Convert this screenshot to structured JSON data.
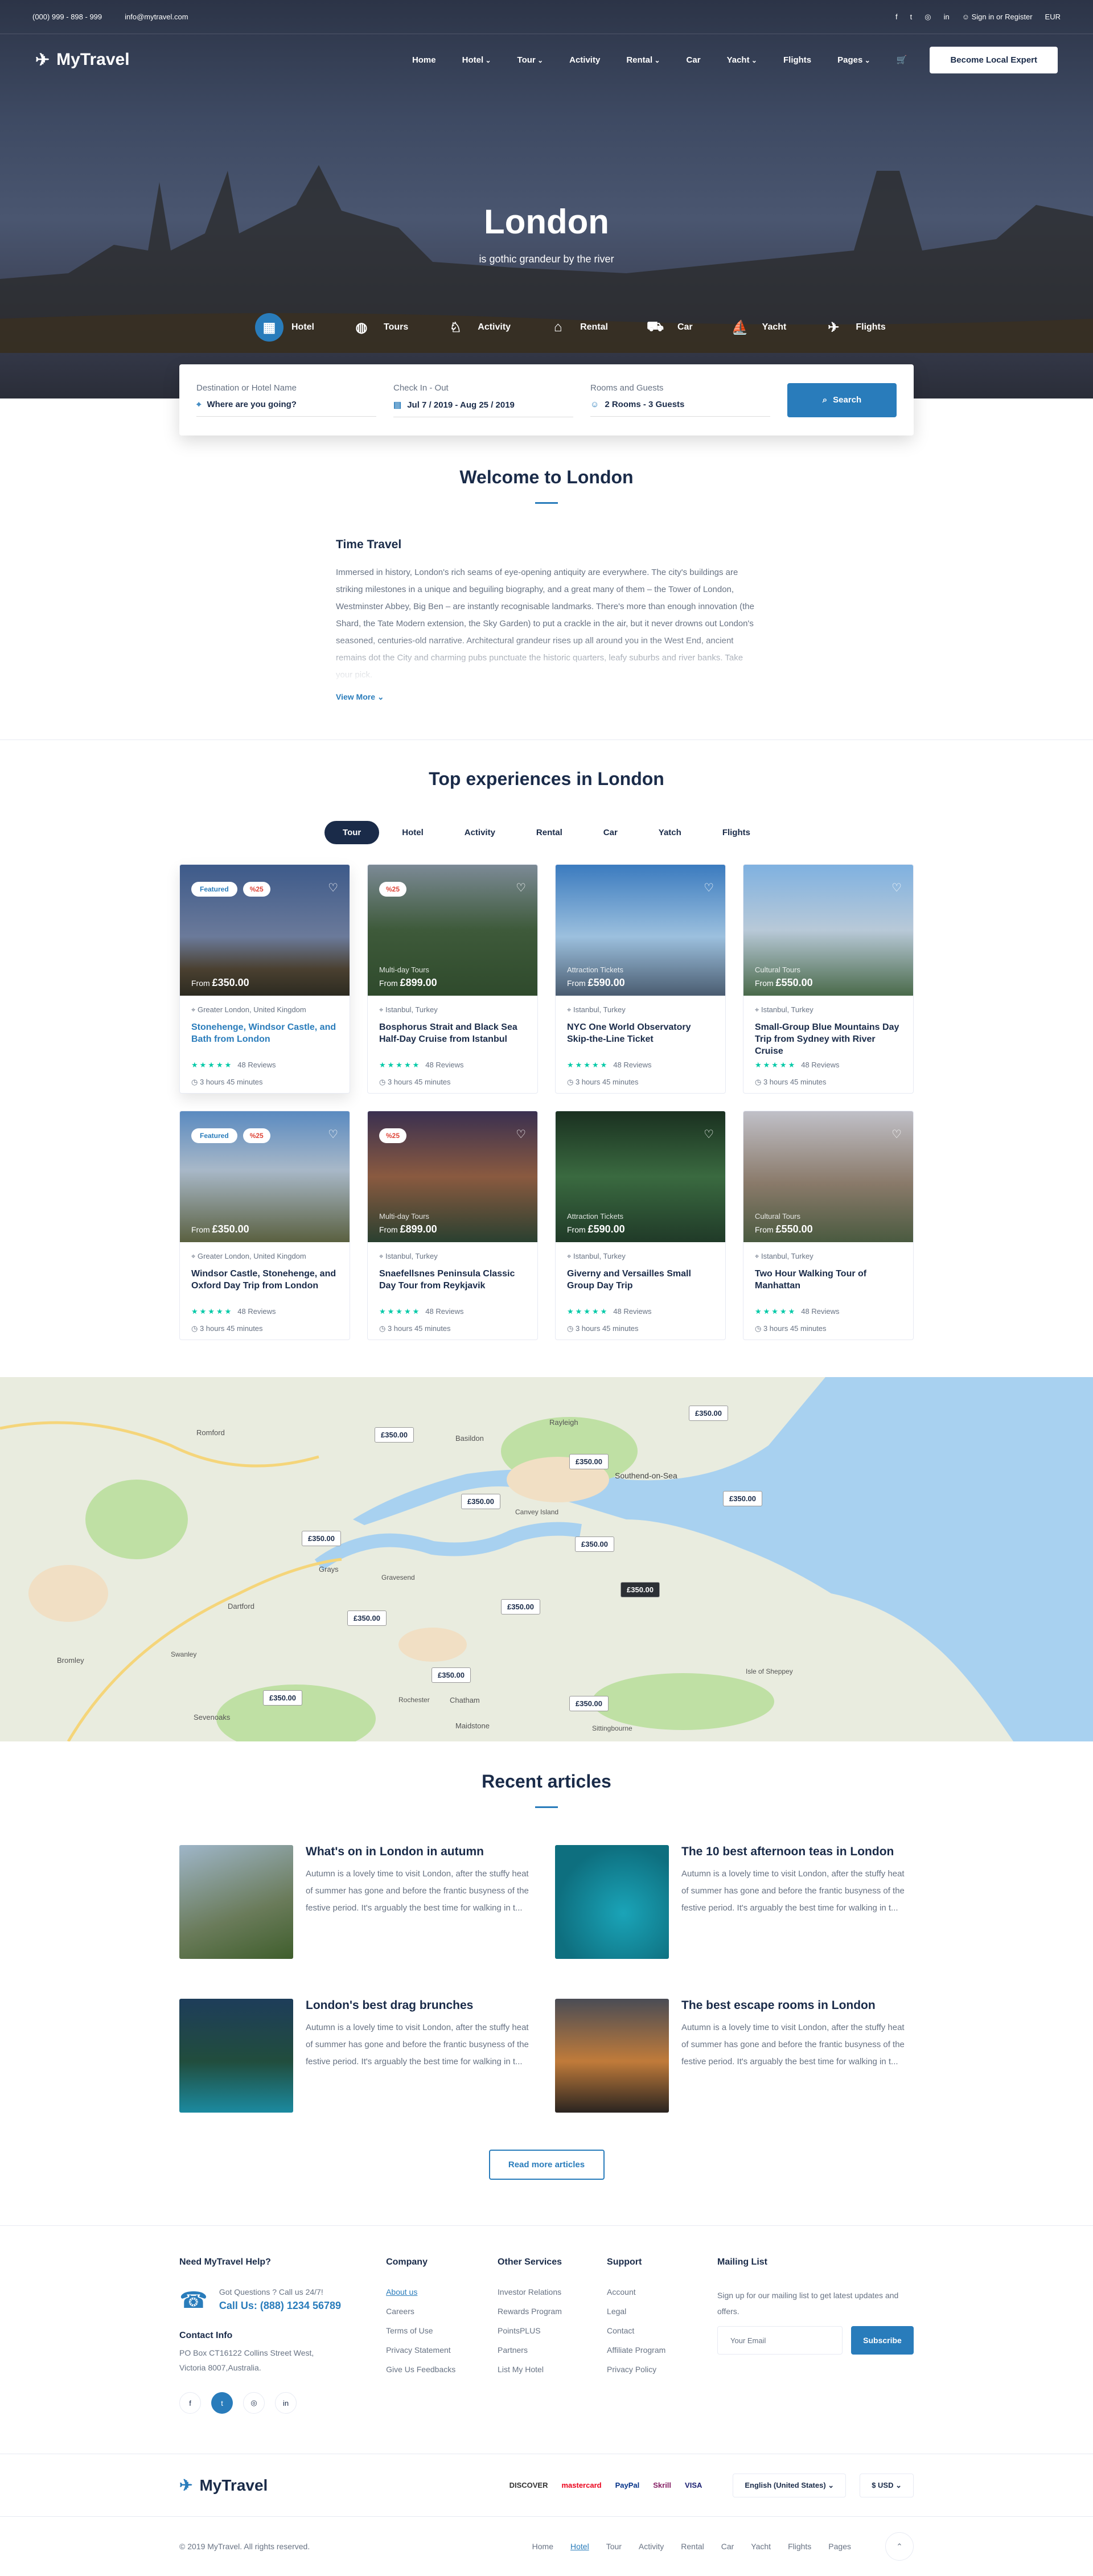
{
  "topbar": {
    "phone": "(000) 999 - 898 - 999",
    "email": "info@mytravel.com",
    "signin": "Sign in or Register",
    "currency": "EUR"
  },
  "nav": {
    "brand": "MyTravel",
    "items": [
      "Home",
      "Hotel",
      "Tour",
      "Activity",
      "Rental",
      "Car",
      "Yacht",
      "Flights",
      "Pages"
    ],
    "cta": "Become Local Expert"
  },
  "hero": {
    "title": "London",
    "subtitle": "is gothic grandeur by the river",
    "tabs": [
      "Hotel",
      "Tours",
      "Activity",
      "Rental",
      "Car",
      "Yacht",
      "Flights"
    ]
  },
  "search": {
    "dest_label": "Destination or Hotel Name",
    "dest_placeholder": "Where are you going?",
    "dates_label": "Check In - Out",
    "dates_value": "Jul 7 / 2019 - Aug 25 / 2019",
    "rooms_label": "Rooms and Guests",
    "rooms_value": "2 Rooms - 3 Guests",
    "button": "Search"
  },
  "welcome": {
    "title": "Welcome to London",
    "subtitle": "Time Travel",
    "text": "Immersed in history, London's rich seams of eye-opening antiquity are everywhere. The city's buildings are striking milestones in a unique and beguiling biography, and a great many of them – the Tower of London, Westminster Abbey, Big Ben – are instantly recognisable landmarks. There's more than enough innovation (the Shard, the Tate Modern extension, the Sky Garden) to put a crackle in the air, but it never drowns out London's seasoned, centuries-old narrative. Architectural grandeur rises up all around you in the West End, ancient remains dot the City and charming pubs punctuate the historic quarters, leafy suburbs and river banks. Take your pick.",
    "more": "View More"
  },
  "experiences": {
    "title": "Top experiences in London",
    "tabs": [
      "Tour",
      "Hotel",
      "Activity",
      "Rental",
      "Car",
      "Yatch",
      "Flights"
    ],
    "cards": [
      {
        "featured": "Featured",
        "discount": "%25",
        "category": "",
        "price_prefix": "From",
        "price": "£350.00",
        "location": "Greater London, United Kingdom",
        "title": "Stonehenge, Windsor Castle, and Bath from London",
        "reviews": "48 Reviews",
        "duration": "3 hours 45 minutes"
      },
      {
        "featured": "",
        "discount": "%25",
        "category": "Multi-day Tours",
        "price_prefix": "From",
        "price": "£899.00",
        "location": "Istanbul, Turkey",
        "title": "Bosphorus Strait and Black Sea Half-Day Cruise from Istanbul",
        "reviews": "48 Reviews",
        "duration": "3 hours 45 minutes"
      },
      {
        "featured": "",
        "discount": "",
        "category": "Attraction Tickets",
        "price_prefix": "From",
        "price": "£590.00",
        "location": "Istanbul, Turkey",
        "title": "NYC One World Observatory Skip-the-Line Ticket",
        "reviews": "48 Reviews",
        "duration": "3 hours 45 minutes"
      },
      {
        "featured": "",
        "discount": "",
        "category": "Cultural Tours",
        "price_prefix": "From",
        "price": "£550.00",
        "location": "Istanbul, Turkey",
        "title": "Small-Group Blue Mountains Day Trip from Sydney with River Cruise",
        "reviews": "48 Reviews",
        "duration": "3 hours 45 minutes"
      },
      {
        "featured": "Featured",
        "discount": "%25",
        "category": "",
        "price_prefix": "From",
        "price": "£350.00",
        "location": "Greater London, United Kingdom",
        "title": "Windsor Castle, Stonehenge, and Oxford Day Trip from London",
        "reviews": "48 Reviews",
        "duration": "3 hours 45 minutes"
      },
      {
        "featured": "",
        "discount": "%25",
        "category": "Multi-day Tours",
        "price_prefix": "From",
        "price": "£899.00",
        "location": "Istanbul, Turkey",
        "title": "Snaefellsnes Peninsula Classic Day Tour from Reykjavik",
        "reviews": "48 Reviews",
        "duration": "3 hours 45 minutes"
      },
      {
        "featured": "",
        "discount": "",
        "category": "Attraction Tickets",
        "price_prefix": "From",
        "price": "£590.00",
        "location": "Istanbul, Turkey",
        "title": "Giverny and Versailles Small Group Day Trip",
        "reviews": "48 Reviews",
        "duration": "3 hours 45 minutes"
      },
      {
        "featured": "",
        "discount": "",
        "category": "Cultural Tours",
        "price_prefix": "From",
        "price": "£550.00",
        "location": "Istanbul, Turkey",
        "title": "Two Hour Walking Tour of Manhattan",
        "reviews": "48 Reviews",
        "duration": "3 hours 45 minutes"
      }
    ]
  },
  "map": {
    "places": [
      "Romford",
      "Basildon",
      "Rayleigh",
      "Southend-on-Sea",
      "Canvey Island",
      "Grays",
      "Dartford",
      "Bromley",
      "Sevenoaks",
      "Maidstone",
      "Chatham",
      "Rochester",
      "Sittingbourne",
      "Isle of Sheppey",
      "Swanley",
      "Gravesend"
    ],
    "markers": [
      "£350.00",
      "£350.00",
      "£350.00",
      "£350.00",
      "£350.00",
      "£350.00",
      "£350.00",
      "£350.00",
      "£350.00",
      "£350.00",
      "£350.00",
      "£350.00",
      "£350.00"
    ]
  },
  "articles": {
    "title": "Recent articles",
    "items": [
      {
        "title": "What's on in London in autumn",
        "excerpt": "Autumn is a lovely time to visit London, after the stuffy heat of summer has gone and before the frantic busyness of the festive period. It's arguably the best time for walking in t..."
      },
      {
        "title": "The 10 best afternoon teas in London",
        "excerpt": "Autumn is a lovely time to visit London, after the stuffy heat of summer has gone and before the frantic busyness of the festive period. It's arguably the best time for walking in t..."
      },
      {
        "title": "London's best drag brunches",
        "excerpt": "Autumn is a lovely time to visit London, after the stuffy heat of summer has gone and before the frantic busyness of the festive period. It's arguably the best time for walking in t..."
      },
      {
        "title": "The best escape rooms in London",
        "excerpt": "Autumn is a lovely time to visit London, after the stuffy heat of summer has gone and before the frantic busyness of the festive period. It's arguably the best time for walking in t..."
      }
    ],
    "more": "Read more articles"
  },
  "footer": {
    "help_title": "Need MyTravel Help?",
    "help_q": "Got Questions ? Call us 24/7!",
    "help_call": "Call Us:",
    "help_phone": "(888) 1234 56789",
    "contact_title": "Contact Info",
    "contact_addr": "PO Box CT16122 Collins Street West, Victoria 8007,Australia.",
    "company_title": "Company",
    "company": [
      "About us",
      "Careers",
      "Terms of Use",
      "Privacy Statement",
      "Give Us Feedbacks"
    ],
    "services_title": "Other Services",
    "services": [
      "Investor Relations",
      "Rewards Program",
      "PointsPLUS",
      "Partners",
      "List My Hotel"
    ],
    "support_title": "Support",
    "support": [
      "Account",
      "Legal",
      "Contact",
      "Affiliate Program",
      "Privacy Policy"
    ],
    "mail_title": "Mailing List",
    "mail_text": "Sign up for our mailing list to get latest updates and offers.",
    "mail_placeholder": "Your Email",
    "mail_button": "Subscribe",
    "payments": [
      "DISCOVER",
      "mastercard",
      "PayPal",
      "Skrill",
      "VISA"
    ],
    "language": "English (United States)",
    "currency": "$ USD",
    "copyright": "© 2019 MyTravel. All rights reserved.",
    "bottom_links": [
      "Home",
      "Hotel",
      "Tour",
      "Activity",
      "Rental",
      "Car",
      "Yacht",
      "Flights",
      "Pages"
    ]
  }
}
